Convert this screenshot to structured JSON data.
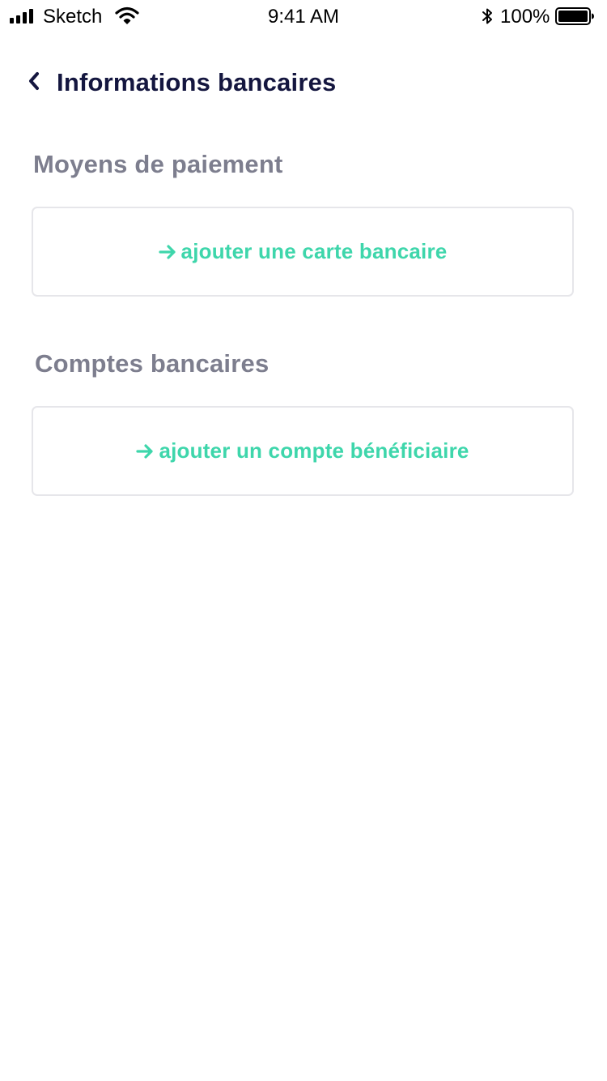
{
  "status_bar": {
    "carrier": "Sketch",
    "time": "9:41 AM",
    "battery_percent": "100%",
    "signal_icon": "signal-bars-icon",
    "wifi_icon": "wifi-icon",
    "bluetooth_icon": "bluetooth-icon",
    "battery_icon": "battery-icon",
    "battery_level": 1.0
  },
  "header": {
    "back_icon": "chevron-left-icon",
    "title": "Informations bancaires"
  },
  "payment_methods": {
    "title": "Moyens de paiement",
    "add_label": "ajouter une carte bancaire",
    "add_icon": "arrow-right-icon"
  },
  "bank_accounts": {
    "title": "Comptes bancaires",
    "add_label": "ajouter un compte bénéficiaire",
    "add_icon": "arrow-right-icon"
  },
  "colors": {
    "title": "#14163f",
    "section_title": "#7d7e8e",
    "accent": "#3ed6ab",
    "card_border": "#e6e6ea"
  }
}
